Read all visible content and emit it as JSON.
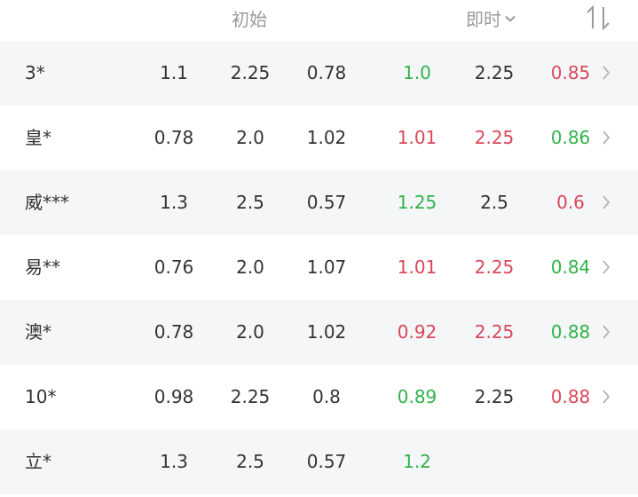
{
  "header": {
    "initial_label": "初始",
    "live_label": "即时"
  },
  "colors": {
    "green": "#2fb34a",
    "red": "#d9485a",
    "dark": "#333333",
    "header_text": "#9a9a9a",
    "row_alt_bg": "#f5f6f7"
  },
  "rows": [
    {
      "name": "3*",
      "i1": "1.1",
      "i2": "2.25",
      "i3": "0.78",
      "l1": "1.0",
      "l1_color": "green",
      "l2": "2.25",
      "l2_color": "dark",
      "l3": "0.85",
      "l3_color": "red",
      "chevron": true
    },
    {
      "name": "皇*",
      "i1": "0.78",
      "i2": "2.0",
      "i3": "1.02",
      "l1": "1.01",
      "l1_color": "red",
      "l2": "2.25",
      "l2_color": "red",
      "l3": "0.86",
      "l3_color": "green",
      "chevron": true
    },
    {
      "name": "威***",
      "i1": "1.3",
      "i2": "2.5",
      "i3": "0.57",
      "l1": "1.25",
      "l1_color": "green",
      "l2": "2.5",
      "l2_color": "dark",
      "l3": "0.6",
      "l3_color": "red",
      "chevron": true
    },
    {
      "name": "易**",
      "i1": "0.76",
      "i2": "2.0",
      "i3": "1.07",
      "l1": "1.01",
      "l1_color": "red",
      "l2": "2.25",
      "l2_color": "red",
      "l3": "0.84",
      "l3_color": "green",
      "chevron": true
    },
    {
      "name": "澳*",
      "i1": "0.78",
      "i2": "2.0",
      "i3": "1.02",
      "l1": "0.92",
      "l1_color": "red",
      "l2": "2.25",
      "l2_color": "red",
      "l3": "0.88",
      "l3_color": "green",
      "chevron": true
    },
    {
      "name": "10*",
      "i1": "0.98",
      "i2": "2.25",
      "i3": "0.8",
      "l1": "0.89",
      "l1_color": "green",
      "l2": "2.25",
      "l2_color": "dark",
      "l3": "0.88",
      "l3_color": "red",
      "chevron": true
    },
    {
      "name": "立*",
      "i1": "1.3",
      "i2": "2.5",
      "i3": "0.57",
      "l1": "1.2",
      "l1_color": "green",
      "l2": "",
      "l2_color": "dark",
      "l3": "",
      "l3_color": "dark",
      "chevron": false
    }
  ]
}
